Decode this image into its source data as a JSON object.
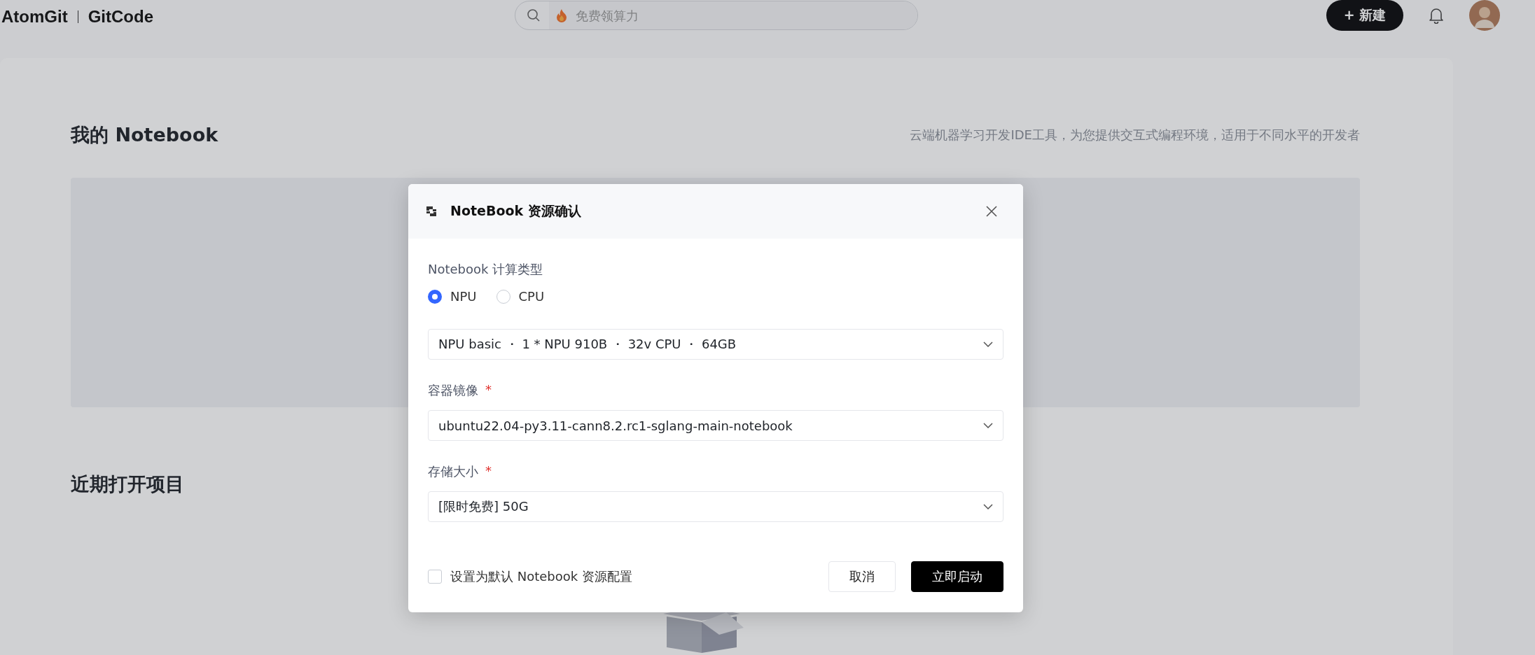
{
  "header": {
    "logo_left": "AtomGit",
    "logo_right": "GitCode",
    "search": {
      "placeholder": "免费领算力"
    },
    "new_button": "+ 新建"
  },
  "page": {
    "title": "我的 Notebook",
    "subtitle": "云端机器学习开发IDE工具，为您提供交互式编程环境，适用于不同水平的开发者",
    "recent_title": "近期打开项目"
  },
  "dialog": {
    "title": "NoteBook 资源确认",
    "compute_label": "Notebook 计算类型",
    "compute_options": [
      {
        "label": "NPU",
        "selected": true
      },
      {
        "label": "CPU",
        "selected": false
      }
    ],
    "fields": [
      {
        "value": "NPU basic ・ 1 * NPU 910B ・ 32v CPU ・ 64GB"
      },
      {
        "label": "容器镜像",
        "required_mark": "*",
        "value": "ubuntu22.04-py3.11-cann8.2.rc1-sglang-main-notebook"
      },
      {
        "label": "存储大小",
        "required_mark": "*",
        "value": "[限时免费] 50G"
      }
    ],
    "default_checkbox": {
      "label": "设置为默认 Notebook 资源配置",
      "checked": false
    },
    "buttons": [
      {
        "label": "取消",
        "kind": "secondary"
      },
      {
        "label": "立即启动",
        "kind": "primary"
      }
    ]
  }
}
